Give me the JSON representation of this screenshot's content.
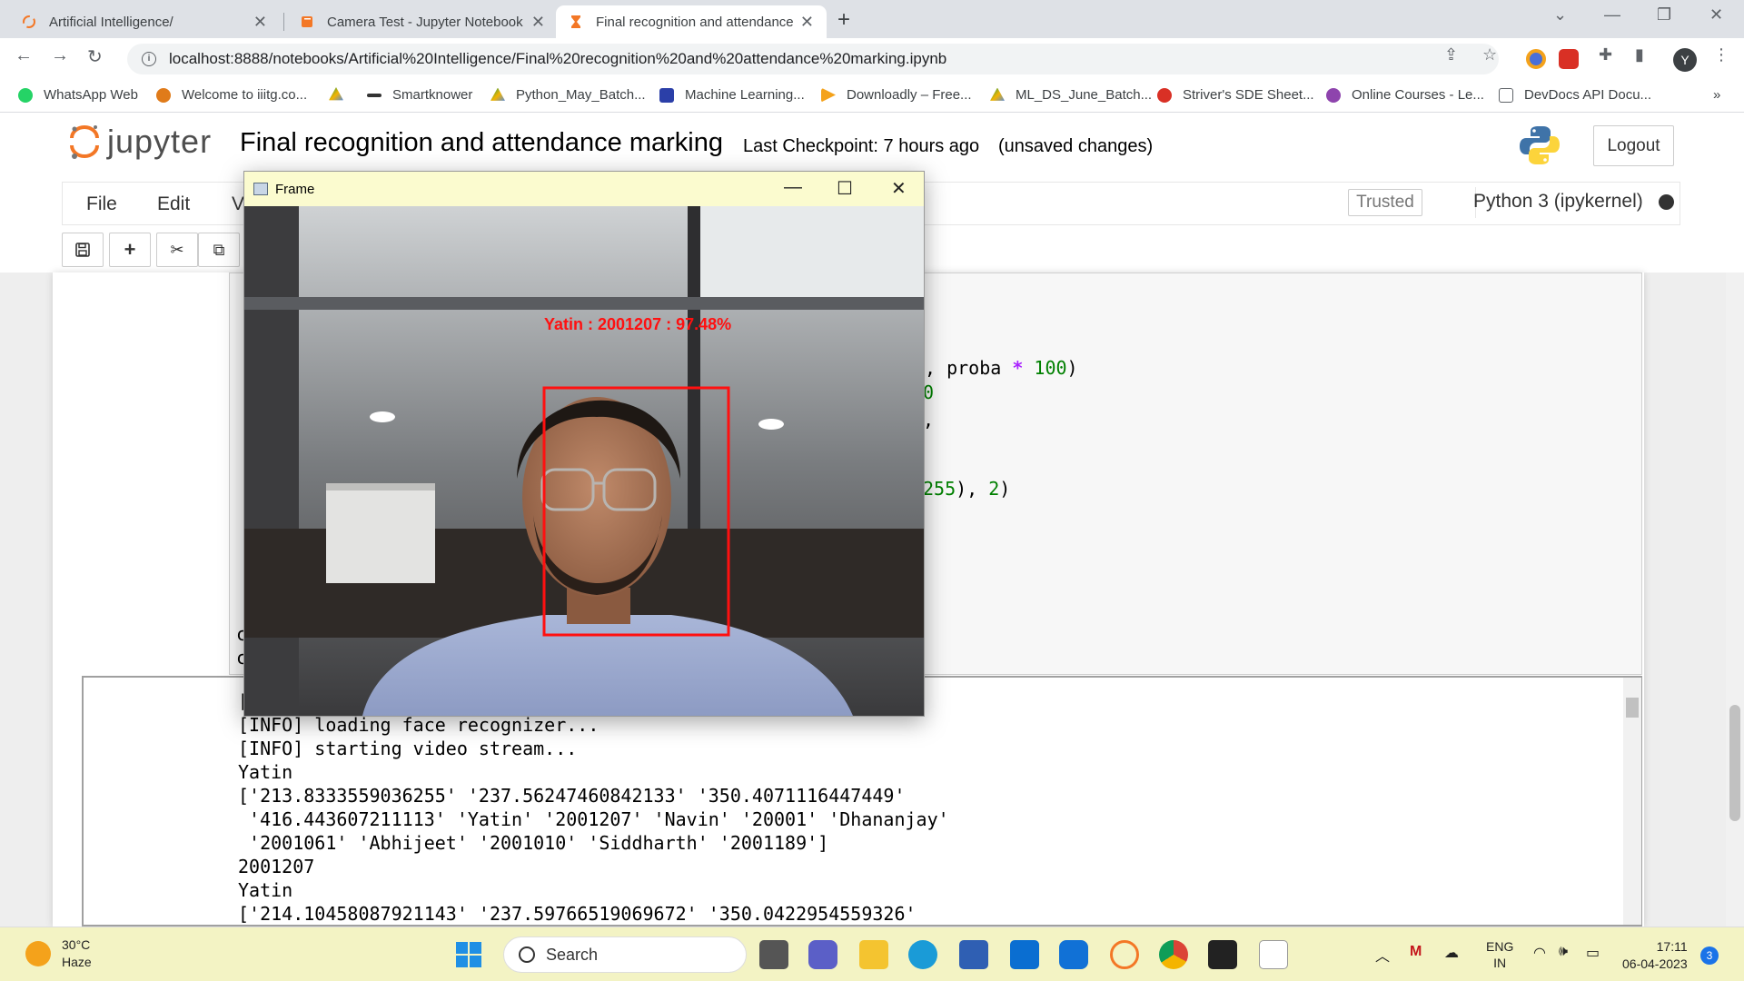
{
  "browser": {
    "tabs": [
      {
        "title": "Artificial Intelligence/",
        "active": false
      },
      {
        "title": "Camera Test - Jupyter Notebook",
        "active": false
      },
      {
        "title": "Final recognition and attendance",
        "active": true
      }
    ],
    "url": "localhost:8888/notebooks/Artificial%20Intelligence/Final%20recognition%20and%20attendance%20marking.ipynb",
    "avatar_letter": "Y",
    "bookmarks": [
      "WhatsApp Web",
      "Welcome to iiitg.co...",
      "Smartknower",
      "Python_May_Batch...",
      "Machine Learning...",
      "Downloadly – Free...",
      "ML_DS_June_Batch...",
      "Striver's SDE Sheet...",
      "Online Courses - Le...",
      "DevDocs API Docu..."
    ],
    "bookmarks_overflow": "»"
  },
  "jupyter": {
    "logo_text": "jupyter",
    "notebook_name": "Final recognition and attendance marking",
    "checkpoint": "Last Checkpoint: 7 hours ago",
    "status": "(unsaved changes)",
    "logout_label": "Logout",
    "menu": [
      "File",
      "Edit",
      "V"
    ],
    "trusted_label": "Trusted",
    "kernel_label": "Python 3 (ipykernel)"
  },
  "code_fragments": {
    "line1_a": ", proba ",
    "line1_op": "*",
    "line1_num": " 100",
    "line1_b": ")",
    "line2": "0",
    "line3": ",",
    "line4_num": "255",
    "line4_b": "), ",
    "line4_num2": "2",
    "line4_c": ")",
    "stub1": "c",
    "stub2": "c"
  },
  "output_lines": [
    "[",
    "[INFO] loading face recognizer...",
    "[INFO] starting video stream...",
    "Yatin",
    "['213.8333559036255' '237.56247460842133' '350.4071116447449'",
    " '416.443607211113' 'Yatin' '2001207' 'Navin' '20001' 'Dhananjay'",
    " '2001061' 'Abhijeet' '2001010' 'Siddharth' '2001189']",
    "2001207",
    "Yatin",
    "['214.10458087921143' '237.59766519069672' '350.0422954559326'"
  ],
  "frame_window": {
    "title": "Frame",
    "face_label": "Yatin : 2001207 : 97.48%"
  },
  "taskbar": {
    "temperature": "30°C",
    "condition": "Haze",
    "search_label": "Search",
    "language": "ENG",
    "region": "IN",
    "time": "17:11",
    "date": "06-04-2023",
    "notification_count": "3"
  },
  "colors": {
    "frame_titlebar": "#fbfbcf",
    "face_box": "#ff1010",
    "taskbar": "#f3f3c4",
    "jupyter_orange": "#f37726"
  }
}
